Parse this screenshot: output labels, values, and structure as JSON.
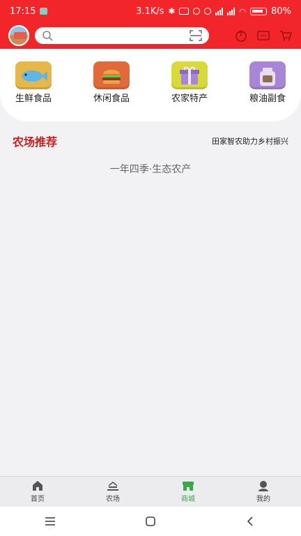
{
  "status_bar": {
    "time": "17:15",
    "net_speed": "3.1K/s",
    "battery": "80%"
  },
  "header": {
    "search_placeholder": ""
  },
  "categories": [
    {
      "label": "生鲜食品",
      "color": "#e6b84a"
    },
    {
      "label": "休闲食品",
      "color": "#e26a3a"
    },
    {
      "label": "农家特产",
      "color": "#d9d93a"
    },
    {
      "label": "粮油副食",
      "color": "#a985d6"
    }
  ],
  "section": {
    "title": "农场推荐",
    "subtitle": "田家智农助力乡村振兴"
  },
  "slogan": "一年四季·生态农产",
  "tabs": [
    {
      "label": "首页",
      "icon": "home-icon"
    },
    {
      "label": "农场",
      "icon": "farm-icon"
    },
    {
      "label": "商城",
      "icon": "store-icon",
      "active": true
    },
    {
      "label": "我的",
      "icon": "user-icon"
    }
  ],
  "colors": {
    "brand_red": "#f2262a",
    "title_red": "#c81e1e",
    "active_green": "#3aa84a"
  }
}
